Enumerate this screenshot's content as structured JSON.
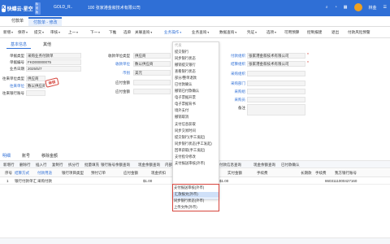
{
  "topbar": {
    "logo_text": "快蝶云·星空",
    "logo_badge": "标准版",
    "acct": "GOLD_R..",
    "org": "100  张家港金叙技术有限公司",
    "user": "林金"
  },
  "tabs": [
    {
      "label": "付款单"
    },
    {
      "label": "付款单 - 修改"
    }
  ],
  "toolbar": [
    "新增",
    "保存",
    "提交",
    "审核",
    "上一",
    "下一",
    "下推",
    "选单",
    "关联查询",
    "业务操作",
    "业务查询",
    "数据查询",
    "凭证",
    "选项",
    "可用预算",
    "控制报建",
    "退出",
    "付款风险预警"
  ],
  "subtabs": [
    "基本信息",
    "其他"
  ],
  "form": {
    "left": [
      {
        "label": "单据类型",
        "value": "采购业务付款单"
      },
      {
        "label": "单据编号",
        "value": "FKD00000075"
      },
      {
        "label": "业务日期",
        "value": "2025/5/7"
      },
      {
        "label": "往来单位类型",
        "value": "供应商"
      },
      {
        "label": "往来单位",
        "value": "数以供应商"
      },
      {
        "label": "往来银行账号",
        "value": ""
      }
    ],
    "mid": [
      {
        "label": "收款单位类型",
        "value": "供应商"
      },
      {
        "label": "收款单位",
        "value": "数以供应商"
      },
      {
        "label": "币别",
        "value": "美元"
      },
      {
        "label": "应付金额",
        "value": ""
      },
      {
        "label": "应付金额",
        "value": ""
      }
    ],
    "right": [
      {
        "label": "付款组织",
        "value": "张家港金叙技术有限公司"
      },
      {
        "label": "结算组织",
        "value": "张家港金叙技术有限公司"
      },
      {
        "label": "采购组织",
        "value": ""
      },
      {
        "label": "采购部门",
        "value": ""
      },
      {
        "label": "采购组",
        "value": ""
      },
      {
        "label": "采购员",
        "value": ""
      },
      {
        "label": "备注",
        "value": ""
      }
    ],
    "stamp": "审核"
  },
  "menu": {
    "items": [
      "代发",
      "提交银行",
      "同步银行状态",
      "撤销提交银行",
      "查看银行状态",
      "部分/整单退款",
      "已付款确认",
      "撤销已付款确认",
      "电子票据开票",
      "电子票据背书",
      "境外支付",
      "撤销取消",
      "支付信息获取",
      "同步交易时间",
      "提交银行(手工发起)",
      "同步银行状态(手工发起)",
      "回单获取(手工发起)",
      "支付指令修改",
      "支付报送审核(外币)",
      "汇款报文(外币)",
      "同步银行状态(外币)",
      "上传文件(外币)"
    ],
    "highlighted": "汇款报文(外币)"
  },
  "bottom": {
    "tabs": [
      "明细",
      "账号",
      "移除金额"
    ],
    "tools": [
      "新增行",
      "删除行",
      "插入行",
      "复制行",
      "拆分行",
      "批量填充",
      "银行账号余额查询",
      "现金余额查询",
      "内部账户余额查询",
      "账户服务",
      "付款信息查询",
      "现金余额查询",
      "已付款确认"
    ],
    "columns": [
      "序号",
      "结算方式",
      "付款用途",
      "银行项目类型",
      "预付订单",
      "应付金额",
      "现金折扣",
      "实付金额",
      "手续费",
      "长期款",
      "手续费",
      "我方银行账号"
    ],
    "row": {
      "no": "1",
      "method": "银行付款单汇",
      "purpose": "采购付款",
      "amount": "$1.00",
      "paid": "$1.00",
      "account": "8603111000427160"
    }
  }
}
